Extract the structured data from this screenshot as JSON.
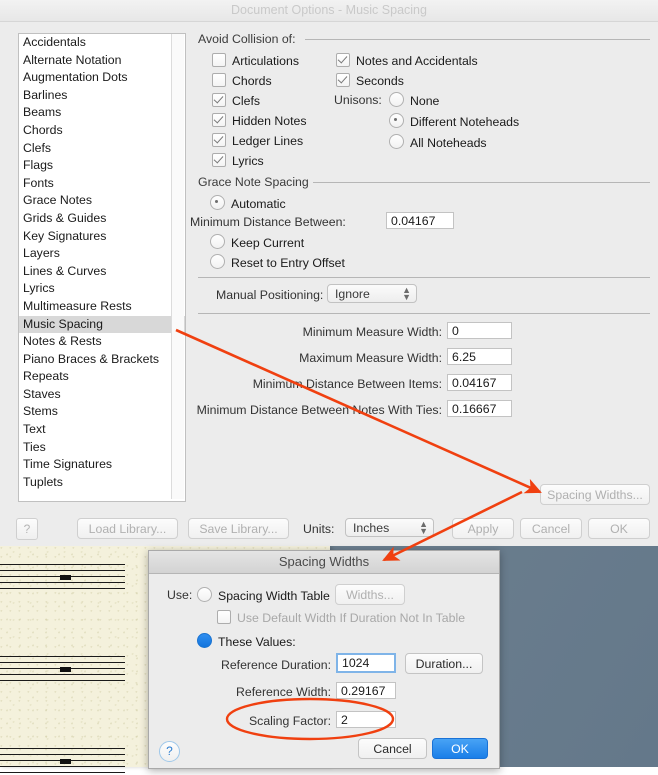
{
  "desktop": {
    "background_color": "#6c8091",
    "score_paper_color": "#f4f1dc"
  },
  "main_dialog": {
    "title": "Document Options - Music Spacing",
    "categories": [
      "Accidentals",
      "Alternate Notation",
      "Augmentation Dots",
      "Barlines",
      "Beams",
      "Chords",
      "Clefs",
      "Flags",
      "Fonts",
      "Grace Notes",
      "Grids & Guides",
      "Key Signatures",
      "Layers",
      "Lines & Curves",
      "Lyrics",
      "Multimeasure Rests",
      "Music Spacing",
      "Notes & Rests",
      "Piano Braces & Brackets",
      "Repeats",
      "Staves",
      "Stems",
      "Text",
      "Ties",
      "Time Signatures",
      "Tuplets"
    ],
    "selected_category": "Music Spacing",
    "avoid_collision": {
      "group_label": "Avoid Collision of:",
      "left_checkboxes": [
        {
          "label": "Articulations",
          "checked": false
        },
        {
          "label": "Chords",
          "checked": false
        },
        {
          "label": "Clefs",
          "checked": true
        },
        {
          "label": "Hidden Notes",
          "checked": true
        },
        {
          "label": "Ledger Lines",
          "checked": true
        },
        {
          "label": "Lyrics",
          "checked": true
        }
      ],
      "right_checkboxes": [
        {
          "label": "Notes and Accidentals",
          "checked": true
        },
        {
          "label": "Seconds",
          "checked": true
        }
      ],
      "unisons_label": "Unisons:",
      "unisons_options": [
        {
          "label": "None",
          "selected": false
        },
        {
          "label": "Different Noteheads",
          "selected": true
        },
        {
          "label": "All Noteheads",
          "selected": false
        }
      ]
    },
    "grace_note_spacing": {
      "group_label": "Grace Note Spacing",
      "options": [
        {
          "label": "Automatic",
          "selected": true
        },
        {
          "label": "Keep Current",
          "selected": false
        },
        {
          "label": "Reset to Entry Offset",
          "selected": false
        }
      ],
      "minimum_distance_label": "Minimum Distance Between:",
      "minimum_distance_value": "0.04167"
    },
    "manual_positioning": {
      "label": "Manual Positioning:",
      "value": "Ignore"
    },
    "measure_fields": [
      {
        "label": "Minimum Measure Width:",
        "value": "0"
      },
      {
        "label": "Maximum Measure Width:",
        "value": "6.25"
      },
      {
        "label": "Minimum Distance Between Items:",
        "value": "0.04167"
      },
      {
        "label": "Minimum Distance Between Notes With Ties:",
        "value": "0.16667"
      }
    ],
    "spacing_widths_button": "Spacing Widths...",
    "footer": {
      "help": "?",
      "load_library": "Load Library...",
      "save_library": "Save Library...",
      "units_label": "Units:",
      "units_value": "Inches",
      "apply": "Apply",
      "cancel": "Cancel",
      "ok": "OK"
    }
  },
  "spacing_widths_dialog": {
    "title": "Spacing Widths",
    "use_label": "Use:",
    "spacing_width_table": {
      "label": "Spacing Width Table",
      "selected": false
    },
    "widths_button": "Widths...",
    "use_default_width": {
      "label": "Use Default Width If Duration Not In Table",
      "checked": false
    },
    "these_values": {
      "label": "These Values:",
      "selected": true
    },
    "reference_duration": {
      "label": "Reference Duration:",
      "value": "1024"
    },
    "duration_button": "Duration...",
    "reference_width": {
      "label": "Reference Width:",
      "value": "0.29167"
    },
    "scaling_factor": {
      "label": "Scaling Factor:",
      "value": "2"
    },
    "help": "?",
    "cancel": "Cancel",
    "ok": "OK"
  },
  "annotations": {
    "color": "#f04010",
    "arrow_1": "music-spacing-to-spacing-widths-button",
    "arrow_2": "spacing-widths-button-to-dialog-title",
    "ellipse": "scaling-factor-highlight"
  }
}
